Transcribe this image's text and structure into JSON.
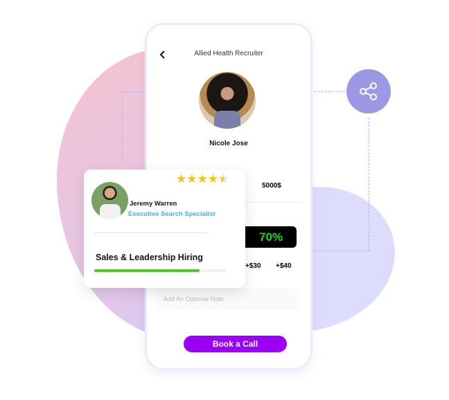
{
  "header": {
    "title": "Allied Health Recruiter",
    "back_icon": "chevron-left-icon"
  },
  "profile": {
    "name": "Nicole Jose"
  },
  "amount": "5000$",
  "percent_badge": "70%",
  "tips": [
    "+$30",
    "+$40"
  ],
  "note": {
    "placeholder": "Add An Optional Note"
  },
  "cta": {
    "label": "Book a Call",
    "color": "#9b00f5"
  },
  "card": {
    "name": "Jeremy Warren",
    "role": "Executive Search Specialist",
    "rating": 4.5,
    "specialty": "Sales & Leadership Hiring",
    "progress": 0.8,
    "progress_color": "#4ccd1f",
    "role_color": "#38b6ff"
  },
  "share_icon": "share-icon"
}
